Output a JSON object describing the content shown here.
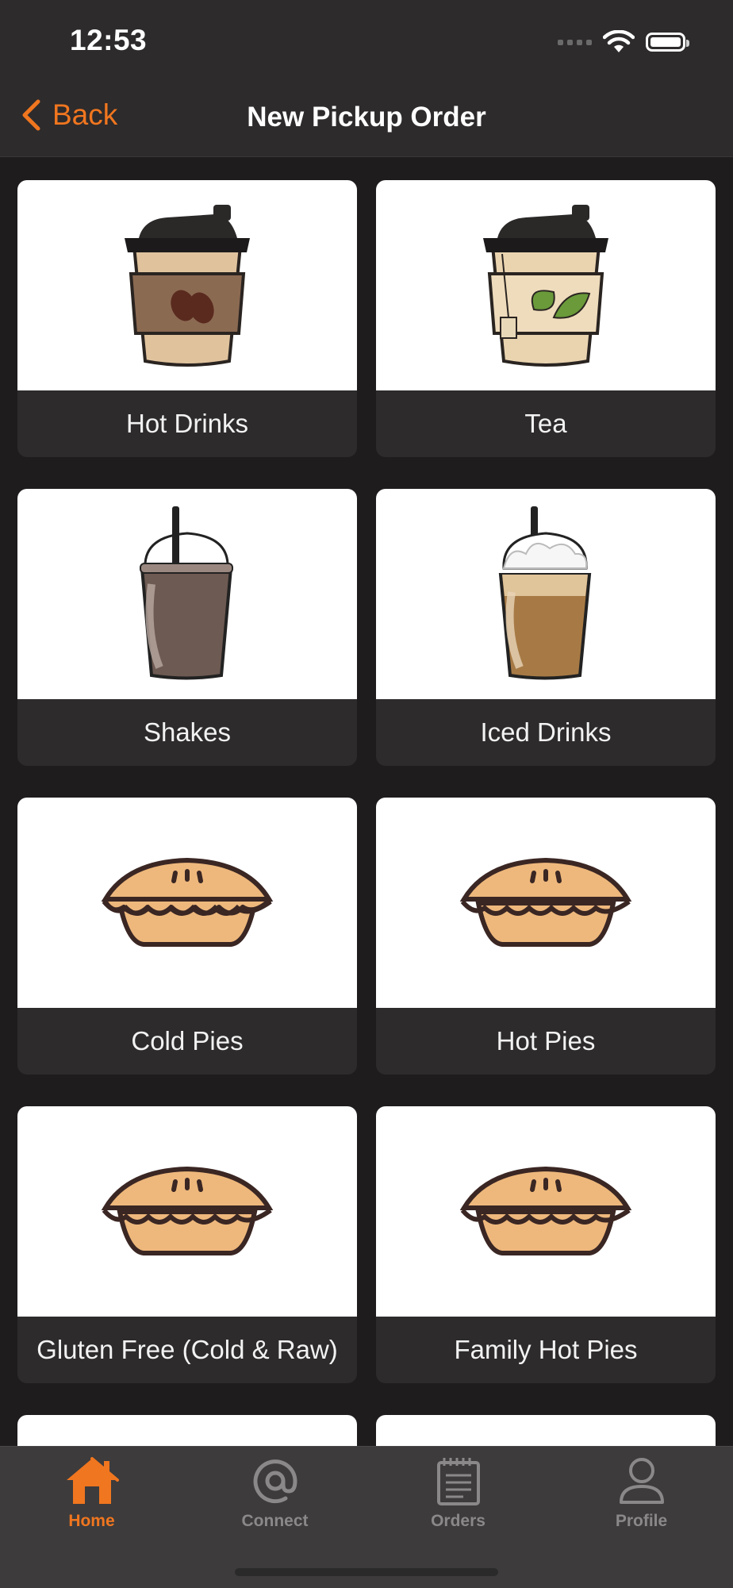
{
  "status_bar": {
    "time": "12:53"
  },
  "nav": {
    "back_label": "Back",
    "title": "New Pickup Order"
  },
  "categories": [
    {
      "label": "Hot Drinks",
      "icon": "coffee-cup-icon"
    },
    {
      "label": "Tea",
      "icon": "tea-cup-icon"
    },
    {
      "label": "Shakes",
      "icon": "shake-cup-icon"
    },
    {
      "label": "Iced Drinks",
      "icon": "iced-drink-icon"
    },
    {
      "label": "Cold Pies",
      "icon": "pie-icon"
    },
    {
      "label": "Hot Pies",
      "icon": "pie-icon"
    },
    {
      "label": "Gluten Free (Cold & Raw)",
      "icon": "pie-icon"
    },
    {
      "label": "Family Hot Pies",
      "icon": "pie-icon"
    }
  ],
  "tabbar": {
    "items": [
      {
        "label": "Home",
        "icon": "home-icon",
        "active": true
      },
      {
        "label": "Connect",
        "icon": "at-icon",
        "active": false
      },
      {
        "label": "Orders",
        "icon": "notepad-icon",
        "active": false
      },
      {
        "label": "Profile",
        "icon": "person-icon",
        "active": false
      }
    ]
  },
  "colors": {
    "accent": "#f0761f",
    "background": "#1f1c1d",
    "bar": "#2d2b2c"
  }
}
